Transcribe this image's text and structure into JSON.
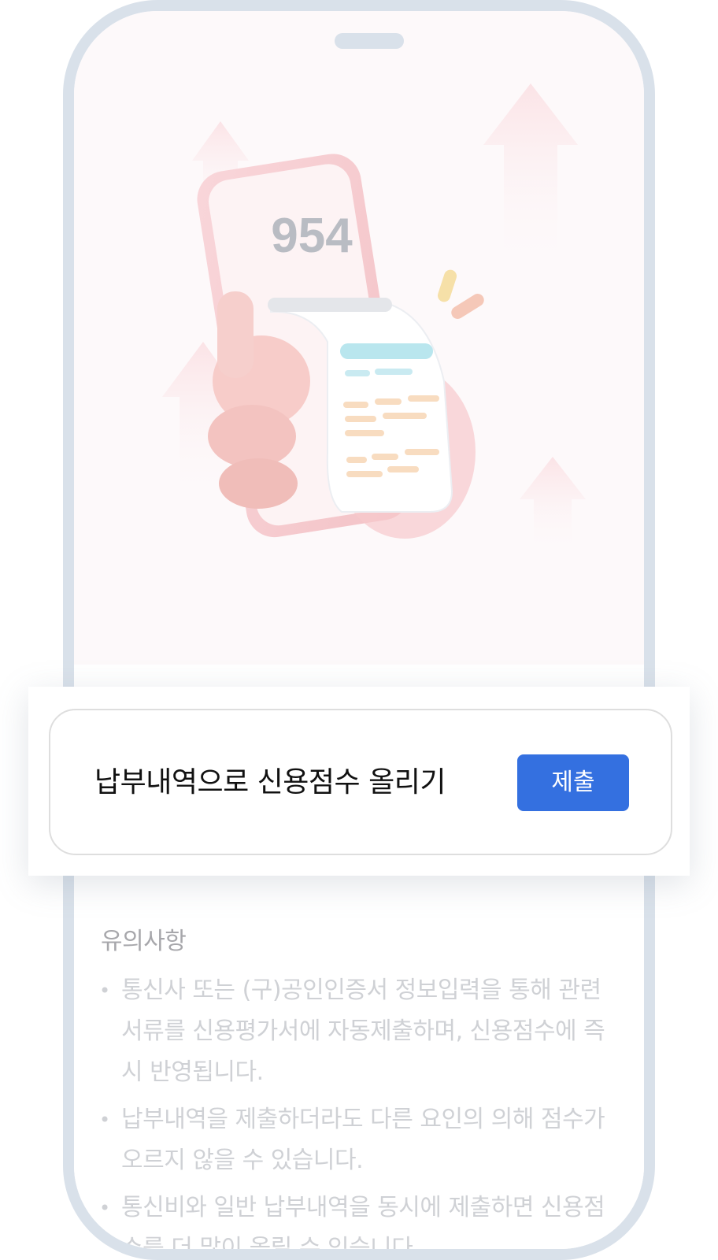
{
  "hero": {
    "score": "954"
  },
  "popup": {
    "title": "납부내역으로 신용점수 올리기",
    "submit_label": "제출"
  },
  "notes": {
    "title": "유의사항",
    "bullet": "•",
    "items": [
      "통신사 또는 (구)공인인증서 정보입력을 통해 관련 서류를 신용평가서에 자동제출하며, 신용점수에 즉시 반영됩니다.",
      "납부내역을 제출하더라도 다른 요인의 의해 점수가 오르지 않을 수 있습니다.",
      "통신비와 일반 납부내역을 동시에 제출하면 신용점수를 더 많이 올릴 수 있습니다."
    ]
  }
}
